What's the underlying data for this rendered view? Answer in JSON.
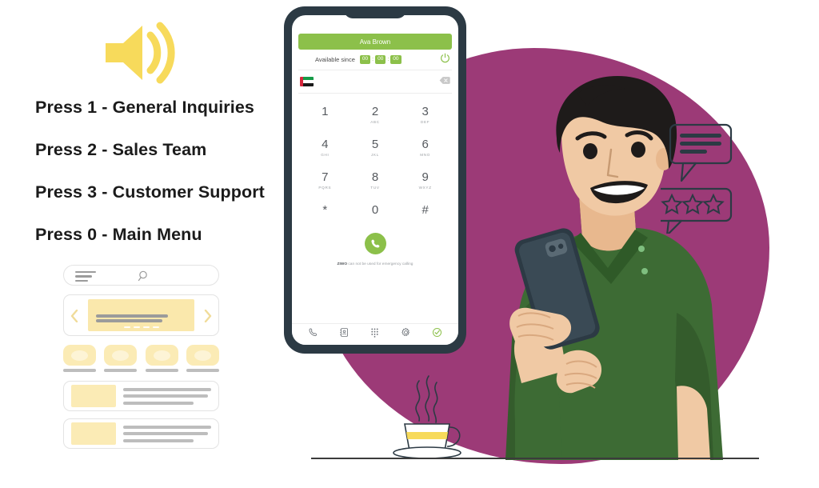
{
  "scene": {
    "title": "IVR phone menu illustration",
    "colors": {
      "blob_magenta": "#9C3A77",
      "accent_green": "#8CC04A",
      "accent_yellow": "#F7DA5B",
      "card_yellow": "#FAE8AC",
      "phone_frame": "#2C3A44",
      "shirt_green": "#3D6B34",
      "text_dark": "#1b1b1b"
    }
  },
  "speaker": {
    "icon": "speaker-announcement-icon",
    "waves": 2
  },
  "ivr_menu": {
    "items": [
      {
        "label": "Press 1 - General Inquiries"
      },
      {
        "label": "Press 2 - Sales Team"
      },
      {
        "label": "Press 3 - Customer Support"
      },
      {
        "label": "Press 0 - Main Menu"
      }
    ]
  },
  "wireframe": {
    "search": {
      "menu_icon": "hamburger-menu-icon",
      "search_icon": "search-icon"
    },
    "carousel": {
      "prev_icon": "chevron-left-icon",
      "next_icon": "chevron-right-icon",
      "dots": 4
    },
    "categories": [
      {},
      {},
      {},
      {}
    ],
    "list_rows": [
      {},
      {}
    ]
  },
  "phone": {
    "header": {
      "contact_name": "Ava Brown"
    },
    "status": {
      "label": "Available since",
      "hours": "00",
      "separator": ":",
      "minutes": "00",
      "seconds": "00",
      "power_icon": "power-icon"
    },
    "number_field": {
      "flag": "uae-flag-icon",
      "value": "",
      "backspace_icon": "backspace-icon"
    },
    "dialpad": [
      {
        "digit": "1",
        "letters": ""
      },
      {
        "digit": "2",
        "letters": "ABC"
      },
      {
        "digit": "3",
        "letters": "DEF"
      },
      {
        "digit": "4",
        "letters": "GHI"
      },
      {
        "digit": "5",
        "letters": "JKL"
      },
      {
        "digit": "6",
        "letters": "MNO"
      },
      {
        "digit": "7",
        "letters": "PQRS"
      },
      {
        "digit": "8",
        "letters": "TUV"
      },
      {
        "digit": "9",
        "letters": "WXYZ"
      },
      {
        "digit": "*",
        "letters": ""
      },
      {
        "digit": "0",
        "letters": ""
      },
      {
        "digit": "#",
        "letters": ""
      }
    ],
    "call_button": {
      "icon": "phone-call-icon"
    },
    "disclaimer": {
      "brand": "ZIWO",
      "text": " can not be used for emergency calling"
    },
    "bottom_nav": [
      {
        "icon": "phone-icon"
      },
      {
        "icon": "contacts-icon"
      },
      {
        "icon": "dialpad-icon"
      },
      {
        "icon": "settings-gear-icon"
      },
      {
        "icon": "check-circle-icon"
      }
    ]
  },
  "bubbles": [
    {
      "icon": "chat-bubble-lines-icon",
      "lines": 3
    },
    {
      "icon": "rating-bubble-stars-icon",
      "stars": 3
    }
  ],
  "illustration": {
    "person": "man-using-smartphone",
    "device": "smartphone-in-hand",
    "coffee": "coffee-cup-icon"
  }
}
